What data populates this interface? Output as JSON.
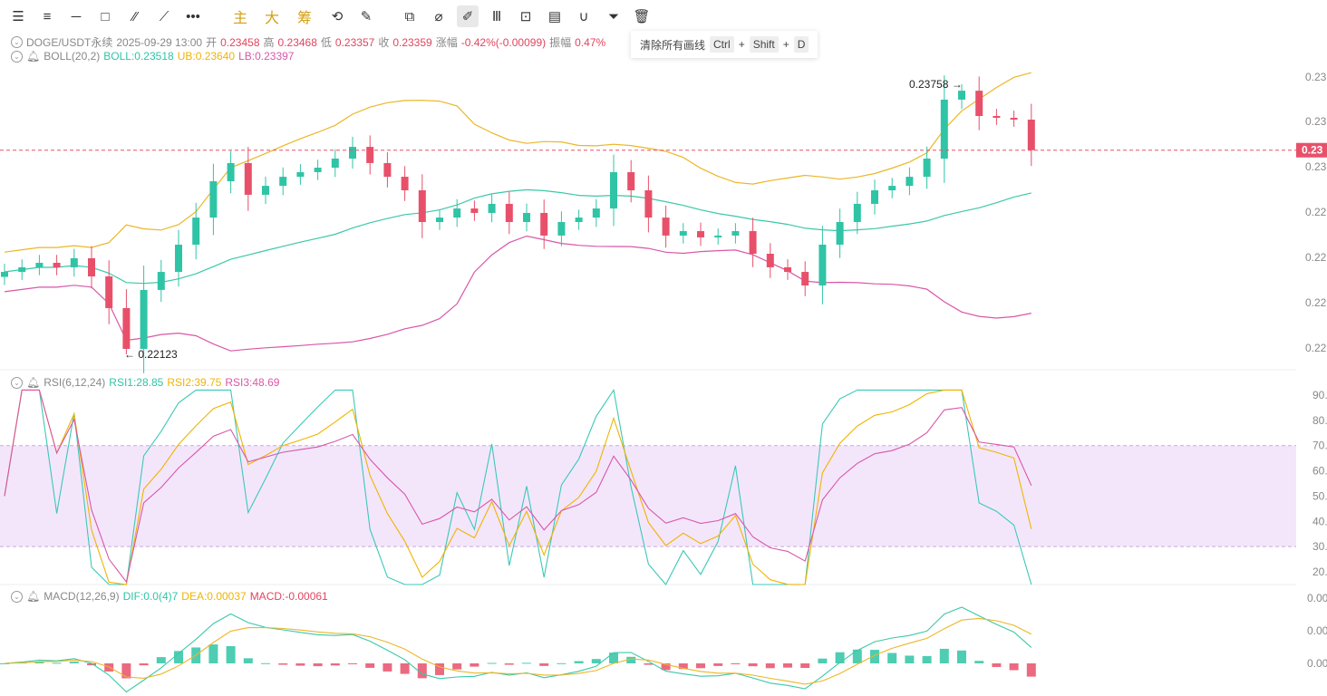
{
  "toolbar": {
    "items": [
      {
        "name": "settings-sliders-icon",
        "glyph": "☰"
      },
      {
        "name": "menu-lines-icon",
        "glyph": "≡"
      },
      {
        "name": "horizontal-line-icon",
        "glyph": "─"
      },
      {
        "name": "rectangle-icon",
        "glyph": "□"
      },
      {
        "name": "wave-pattern-icon",
        "glyph": "⁄⁄"
      },
      {
        "name": "trend-line-icon",
        "glyph": "⟋"
      },
      {
        "name": "more-dots-icon",
        "glyph": "•••"
      },
      {
        "name": "main-indicator-button",
        "glyph": "主"
      },
      {
        "name": "big-trade-button",
        "glyph": "大"
      },
      {
        "name": "chip-distribution-button",
        "glyph": "筹"
      },
      {
        "name": "replay-icon",
        "glyph": "⟲"
      },
      {
        "name": "drawing-tools-icon",
        "glyph": "✎"
      },
      {
        "name": "copy-icon",
        "glyph": "⧉"
      },
      {
        "name": "ruler-icon",
        "glyph": "⌀"
      },
      {
        "name": "pen-draw-icon",
        "glyph": "✐"
      },
      {
        "name": "candle-type-icon",
        "glyph": "Ⅲ"
      },
      {
        "name": "lock-icon",
        "glyph": "⊡"
      },
      {
        "name": "edit-note-icon",
        "glyph": "▤"
      },
      {
        "name": "magnet-icon",
        "glyph": "∪"
      },
      {
        "name": "filter-icon",
        "glyph": "⏷"
      },
      {
        "name": "trash-icon",
        "glyph": "🗑"
      }
    ]
  },
  "tooltip": {
    "label": "清除所有画线",
    "k1": "Ctrl",
    "plus": "+",
    "k2": "Shift",
    "k3": "D"
  },
  "info": {
    "symbol": "DOGE/USDT永续",
    "time": "2025-09-29 13:00",
    "open_label": "开",
    "open": "0.23458",
    "high_label": "高",
    "high": "0.23468",
    "low_label": "低",
    "low": "0.23357",
    "close_label": "收",
    "close": "0.23359",
    "change_label": "涨幅",
    "change": "-0.42%(-0.00099)",
    "amp_label": "振幅",
    "amp": "0.47%"
  },
  "boll": {
    "name": "BOLL(20,2)",
    "mid": "BOLL:0.23518",
    "ub": "UB:0.23640",
    "lb": "LB:0.23397"
  },
  "rsi": {
    "name": "RSI(6,12,24)",
    "r1": "RSI1:28.85",
    "r2": "RSI2:39.75",
    "r3": "RSI3:48.69"
  },
  "macd": {
    "name": "MACD(12,26,9)",
    "dif": "DIF:0.0(4)7",
    "dea": "DEA:0.00037",
    "macd": "MACD:-0.00061"
  },
  "colors": {
    "up": "#2fc4a6",
    "down": "#e8506a",
    "mid": "#3cc8a8",
    "ub": "#ecb625",
    "lb": "#d957a8",
    "rsi1": "#3cc8b8",
    "rsi2": "#f0b400",
    "rsi3": "#d957a8"
  },
  "chart_data": {
    "type": "candlestick",
    "title": "DOGE/USDT永续",
    "price_axis_labels": [
      "0.23",
      "0.23",
      "0.23",
      "0.22",
      "0.22",
      "0.22",
      "0.22"
    ],
    "current_price_label": "0.23",
    "rsi_axis_labels": [
      "90.",
      "80.",
      "70.",
      "60.",
      "50.",
      "40.",
      "30.",
      "20."
    ],
    "macd_axis_labels": [
      "0.00",
      "0.00",
      "0.00"
    ],
    "max_annotation": "0.23758 →",
    "min_annotation": "← 0.22123",
    "max_price": 0.23758,
    "min_price": 0.22123,
    "current_price": 0.23359,
    "rsi_band": [
      30,
      70
    ],
    "closes": [
      0.22622,
      0.2265,
      0.22677,
      0.2265,
      0.22705,
      0.22595,
      0.22403,
      0.22156,
      0.22513,
      0.22622,
      0.22787,
      0.22951,
      0.23171,
      0.23281,
      0.23089,
      0.23143,
      0.23198,
      0.23226,
      0.23253,
      0.23308,
      0.23379,
      0.23281,
      0.23198,
      0.23116,
      0.22924,
      0.22951,
      0.23006,
      0.22979,
      0.23034,
      0.22924,
      0.22979,
      0.22842,
      0.22924,
      0.22951,
      0.23006,
      0.23226,
      0.23116,
      0.22951,
      0.22842,
      0.22869,
      0.22831,
      0.22842,
      0.22869,
      0.22732,
      0.2265,
      0.22622,
      0.2254,
      0.22787,
      0.22924,
      0.23034,
      0.23116,
      0.23143,
      0.23198,
      0.23308,
      0.23665,
      0.23719,
      0.23566,
      0.23555,
      0.23544,
      0.23359
    ]
  }
}
